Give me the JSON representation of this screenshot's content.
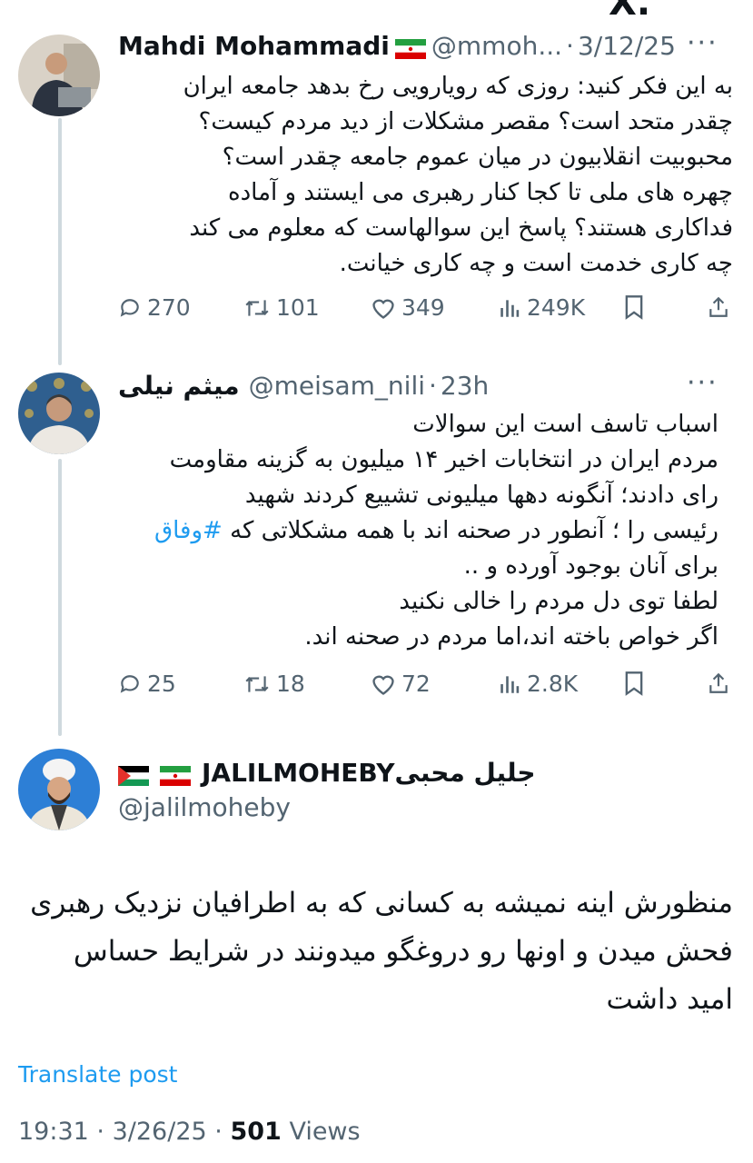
{
  "top_partial_text": "X.",
  "tweets": [
    {
      "name": "Mahdi Mohammadi",
      "handle": "@mmoh...",
      "date": "3/12/25",
      "lines": [
        "به این فکر کنید: روزی که رویارویی رخ بدهد  جامعه ایران",
        "چقدر متحد است؟  مقصر مشکلات از دید مردم کیست؟",
        "محبوبیت انقلابیون در میان عموم جامعه چقدر است؟",
        "چهره های ملی تا کجا کنار رهبری می ایستند و آماده",
        "فداکاری هستند؟ پاسخ این سوالهاست که معلوم می کند",
        "چه کاری خدمت است و چه کاری خیانت."
      ],
      "replies": "270",
      "reposts": "101",
      "likes": "349",
      "views": "249K"
    },
    {
      "name": "میثم نیلی",
      "handle": "@meisam_nili",
      "date": "23h",
      "lines": [
        "اسباب تاسف است این سوالات",
        "مردم ایران در انتخابات اخیر ۱۴ میلیون به گزینه مقاومت",
        "رای دادند؛ آنگونه دهها میلیونی تشییع کردند شهید",
        "رئیسی را ؛ آنطور در صحنه اند با همه مشکلاتی که",
        "برای آنان بوجود آورده و ..",
        "لطفا توی دل مردم را خالی نکنید",
        "اگر خواص باخته اند،اما مردم در صحنه اند."
      ],
      "hashtag": "#وفاق",
      "replies": "25",
      "reposts": "18",
      "likes": "72",
      "views": "2.8K"
    }
  ],
  "main": {
    "name": "JALILMOHEBYجلیل محبی",
    "handle": "@jalilmoheby",
    "lines": [
      "منظورش اینه نمیشه به کسانی که به اطرافیان نزدیک رهبری",
      "فحش میدن و اونها رو دروغگو میدونند در شرایط حساس",
      "امید داشت"
    ],
    "translate": "Translate post",
    "time": "19:31",
    "date": "3/26/25",
    "views_count": "501",
    "views_label": "Views"
  },
  "separator": "·",
  "more_glyph": "···"
}
